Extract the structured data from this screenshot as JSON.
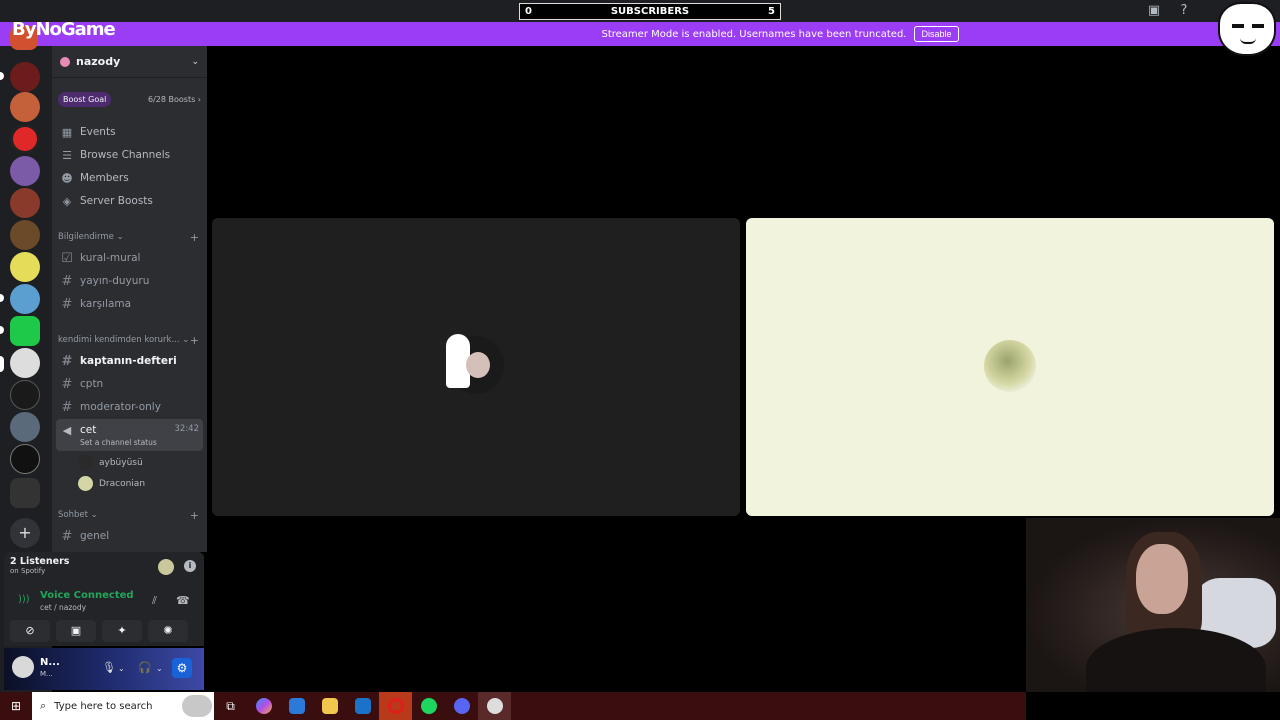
{
  "topbar": {
    "subscribers_left": "0",
    "subscribers_label": "SUBSCRIBERS",
    "subscribers_right": "5"
  },
  "overlay_logo": "ByNoGame",
  "banner": {
    "text": "Streamer Mode is enabled. Usernames have been truncated.",
    "button": "Disable"
  },
  "guild": {
    "name": "nazody",
    "boost_goal_label": "Boost Goal",
    "boost_count": "6/28 Boosts"
  },
  "nav": [
    {
      "label": "Events",
      "icon": "calendar-icon"
    },
    {
      "label": "Browse Channels",
      "icon": "browse-icon"
    },
    {
      "label": "Members",
      "icon": "members-icon"
    },
    {
      "label": "Server Boosts",
      "icon": "boost-icon"
    }
  ],
  "categories": {
    "info": "Bilgilendirme",
    "voice": "kendimi kendimden korurk...",
    "chat": "Sohbet"
  },
  "channels_info": [
    "kural-mural",
    "yayın-duyuru",
    "karşılama"
  ],
  "channels_voice": [
    "kaptanın-defteri",
    "cptn",
    "moderator-only"
  ],
  "active_voice": {
    "name": "cet",
    "time": "32:42",
    "status": "Set a channel status",
    "users": [
      "aybüyüsü",
      "Draconian"
    ]
  },
  "channels_chat": [
    "genel"
  ],
  "listeners": {
    "title": "2 Listeners",
    "subtitle": "on Spotify"
  },
  "voice": {
    "status": "Voice Connected",
    "location": "cet / nazody"
  },
  "user": {
    "name": "N...",
    "status": "M..."
  },
  "taskbar": {
    "search_placeholder": "Type here to search"
  },
  "colors": {
    "banner": "#9b3df5",
    "voice_connected": "#23a55a",
    "sidebar": "#2b2d31",
    "rail": "#1e1f22"
  }
}
